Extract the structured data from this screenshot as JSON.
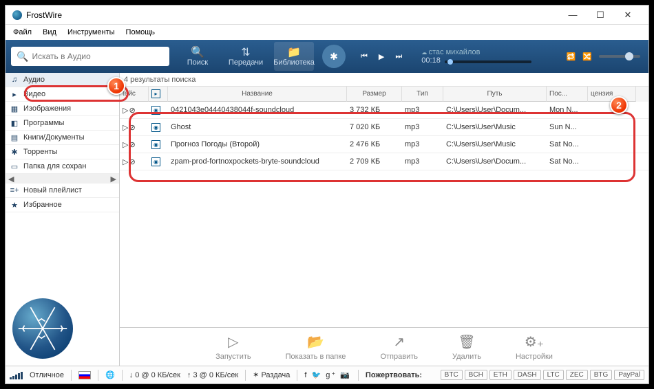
{
  "title": "FrostWire",
  "menu": [
    "Файл",
    "Вид",
    "Инструменты",
    "Помощь"
  ],
  "search_placeholder": "Искать в Аудио",
  "toolbar_buttons": [
    {
      "label": "Поиск",
      "icon": "🔍"
    },
    {
      "label": "Передачи",
      "icon": "⇅"
    },
    {
      "label": "Библиотека",
      "icon": "📁",
      "active": true
    }
  ],
  "nowplaying": {
    "subtitle": "стас михайлов",
    "time": "00:18"
  },
  "sidebar": [
    {
      "icon": "♫",
      "label": "Аудио",
      "sel": true
    },
    {
      "icon": "▸",
      "label": "Видео"
    },
    {
      "icon": "▦",
      "label": "Изображения"
    },
    {
      "icon": "◧",
      "label": "Программы"
    },
    {
      "icon": "▤",
      "label": "Книги/Документы"
    },
    {
      "icon": "✱",
      "label": "Торренты"
    },
    {
      "icon": "▭",
      "label": "Папка для сохран"
    },
    {
      "icon": "≡+",
      "label": "Новый плейлист"
    },
    {
      "icon": "★",
      "label": "Избранное"
    }
  ],
  "results_header": "4 результаты поиска",
  "columns": [
    "tейс",
    "",
    "Название",
    "Размер",
    "Тип",
    "Путь",
    "Пос...",
    "цензия"
  ],
  "rows": [
    {
      "name": "0421043e04440438044f-soundcloud",
      "size": "3 732 КБ",
      "type": "mp3",
      "path": "C:\\Users\\User\\Docum...",
      "date": "Mon N..."
    },
    {
      "name": "Ghost",
      "size": "7 020 КБ",
      "type": "mp3",
      "path": "C:\\Users\\User\\Music",
      "date": "Sun N..."
    },
    {
      "name": "Прогноз Погоды (Второй)",
      "size": "2 476 КБ",
      "type": "mp3",
      "path": "C:\\Users\\User\\Music",
      "date": "Sat No..."
    },
    {
      "name": "zpam-prod-fortnoxpockets-bryte-soundcloud",
      "size": "2 709 КБ",
      "type": "mp3",
      "path": "C:\\Users\\User\\Docum...",
      "date": "Sat No..."
    }
  ],
  "actions": [
    {
      "icon": "▷",
      "label": "Запустить"
    },
    {
      "icon": "📂",
      "label": "Показать в папке"
    },
    {
      "icon": "↗",
      "label": "Отправить"
    },
    {
      "icon": "🗑",
      "label": "Удалить"
    },
    {
      "icon": "⚙₊",
      "label": "Настройки"
    }
  ],
  "status": {
    "quality": "Отличное",
    "down": "0 @ 0 КБ/сек",
    "up": "3 @ 0 КБ/сек",
    "seed": "Раздача",
    "donate": "Пожертвовать:"
  },
  "cryptos": [
    "BTC",
    "BCH",
    "ETH",
    "DASH",
    "LTC",
    "ZEC",
    "BTG",
    "PayPal"
  ]
}
